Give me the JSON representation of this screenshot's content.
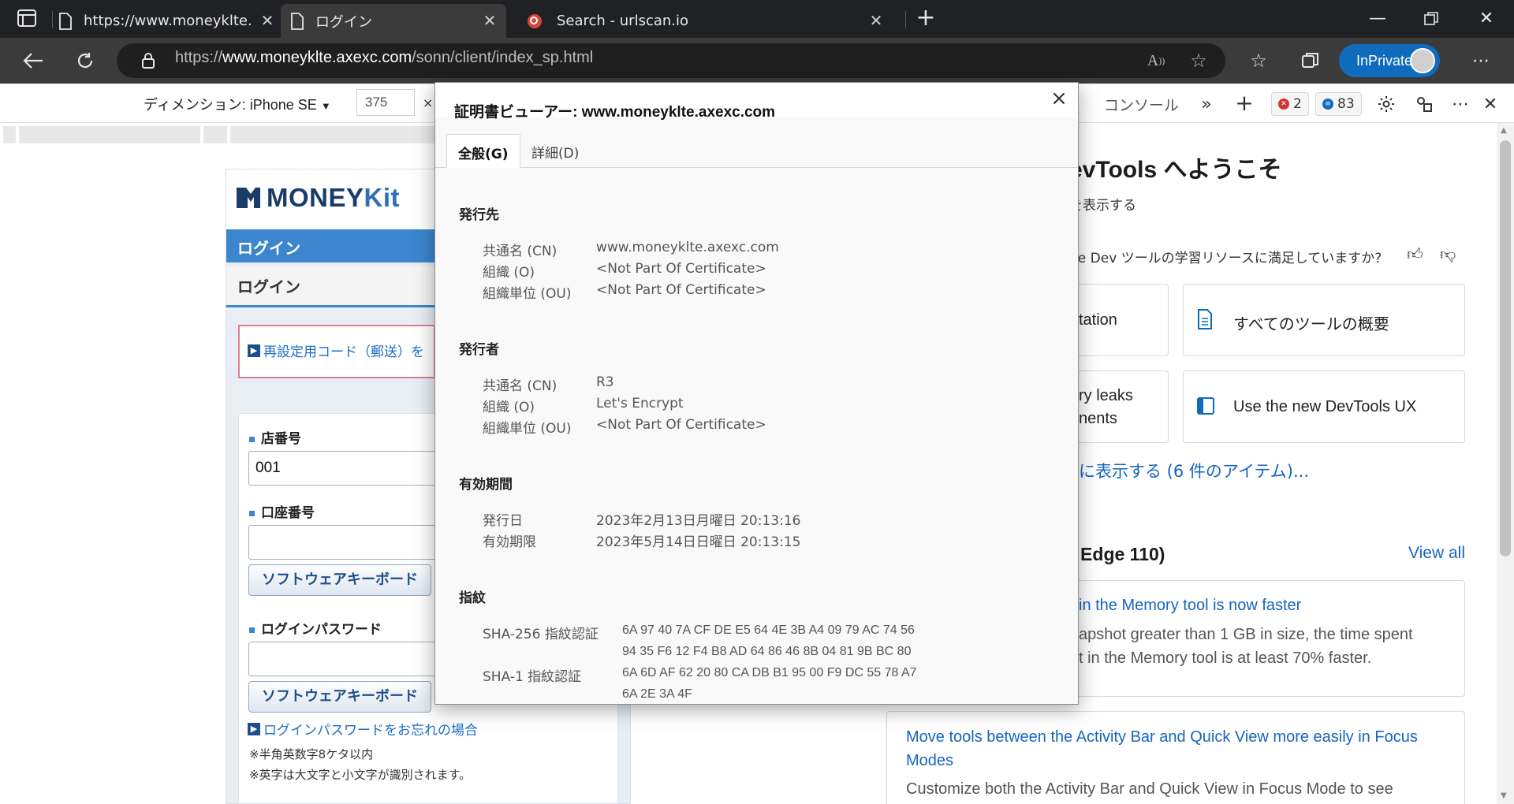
{
  "browser": {
    "tabs": [
      {
        "title": "https://www.moneyklte.axexc.co",
        "active": false
      },
      {
        "title": "ログイン",
        "active": true
      },
      {
        "title": "Search - urlscan.io",
        "active": false
      }
    ],
    "url_prefix": "https://",
    "url_host": "www.moneyklte.axexc.com",
    "url_path": "/sonn/client/index_sp.html",
    "inprivate_label": "InPrivate"
  },
  "device_toolbar": {
    "dimension_label": "ディメンション: iPhone SE",
    "width_value": "375",
    "times": "×"
  },
  "moneykit": {
    "logo_text": "MONEY",
    "logo_kit": "Kit",
    "login_bar": "ログイン",
    "login_sub": "ログイン",
    "reset_link": "再設定用コード（郵送）を",
    "store_label": "店番号",
    "store_value": "001",
    "account_label": "口座番号",
    "account_value": "",
    "keyboard_label": "ソフトウェアキーボード",
    "password_label": "ログインパスワード",
    "password_value": "",
    "forgot_link": "ログインパスワードをお忘れの場合",
    "note1": "※半角英数字8ケタ以内",
    "note2": "※英字は大文字と小文字が識別されます。"
  },
  "devtools": {
    "console_tab": "コンソール",
    "error_count": "2",
    "message_count": "83",
    "welcome_title": "evTools へようこそ",
    "show_text": "を表示する",
    "feedback_question": "ge Dev ツールの学習リソースに満足していますか?",
    "cards": [
      {
        "label": "tation"
      },
      {
        "label": "すべてのツールの概要"
      },
      {
        "label_line1": "ry leaks",
        "label_line2": "nents"
      },
      {
        "label": "Use the new DevTools UX"
      }
    ],
    "show_all": "に表示する (6 件のアイテム)...",
    "whats_new": "t Edge 110)",
    "view_all": "View all",
    "news": [
      {
        "title": "in the Memory tool is now faster",
        "body1": "apshot greater than 1 GB in size, the time spent",
        "body2": "t in the Memory tool is at least 70% faster."
      },
      {
        "title1": "Move tools between the Activity Bar and Quick View more easily in Focus",
        "title2": "Modes",
        "body1": "Customize both the Activity Bar and Quick View in Focus Mode to see"
      }
    ]
  },
  "certificate": {
    "title": "証明書ビューアー: www.moneyklte.axexc.com",
    "close": "×",
    "tab_general": "全般(G)",
    "tab_detail": "詳細(D)",
    "issued_to_heading": "発行先",
    "issued_to": [
      {
        "key": "共通名 (CN)",
        "value": "www.moneyklte.axexc.com"
      },
      {
        "key": "組織 (O)",
        "value": "<Not Part Of Certificate>"
      },
      {
        "key": "組織単位 (OU)",
        "value": "<Not Part Of Certificate>"
      }
    ],
    "issued_by_heading": "発行者",
    "issued_by": [
      {
        "key": "共通名 (CN)",
        "value": "R3"
      },
      {
        "key": "組織 (O)",
        "value": "Let's Encrypt"
      },
      {
        "key": "組織単位 (OU)",
        "value": "<Not Part Of Certificate>"
      }
    ],
    "validity_heading": "有効期間",
    "validity": [
      {
        "key": "発行日",
        "value": "2023年2月13日月曜日 20:13:16"
      },
      {
        "key": "有効期限",
        "value": "2023年5月14日日曜日 20:13:15"
      }
    ],
    "fingerprint_heading": "指紋",
    "sha256_label": "SHA-256 指紋認証",
    "sha256_line1": "6A 97 40 7A CF DE E5 64 4E 3B A4 09 79 AC 74 56",
    "sha256_line2": "94 35 F6 12 F4 B8 AD 64 86 46 8B 04 81 9B BC 80",
    "sha1_label": "SHA-1 指紋認証",
    "sha1_line1": "6A 6D AF 62 20 80 CA DB B1 95 00 F9 DC 55 78 A7",
    "sha1_line2": "6A 2E 3A 4F"
  },
  "colors": {
    "accent": "#0f6cbd",
    "moneykit_blue": "#3b86cc",
    "link": "#1565c0"
  }
}
